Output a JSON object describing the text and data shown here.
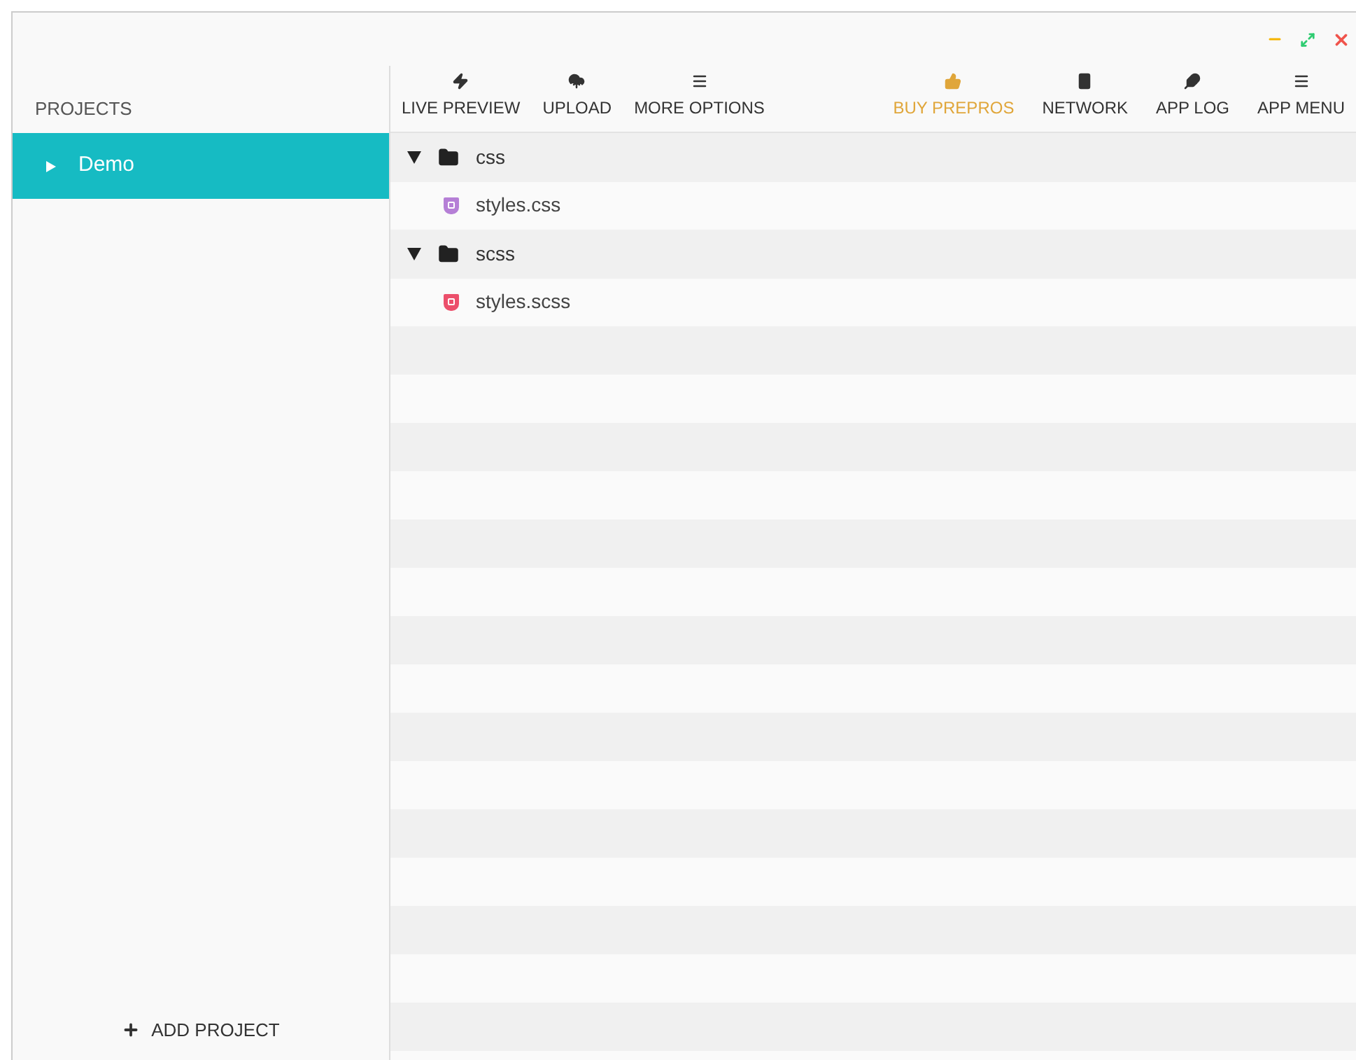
{
  "sidebar": {
    "heading": "PROJECTS",
    "projects": [
      {
        "name": "Demo",
        "selected": true
      }
    ],
    "add_button": "ADD PROJECT"
  },
  "toolbar": {
    "left": [
      {
        "label": "LIVE PREVIEW",
        "kind": "bolt",
        "highlighted": false
      },
      {
        "label": "UPLOAD",
        "kind": "cloud",
        "highlighted": false
      },
      {
        "label": "MORE OPTIONS",
        "kind": "menu",
        "highlighted": false
      }
    ],
    "right": [
      {
        "label": "BUY PREPROS",
        "kind": "thumb",
        "highlighted": true
      },
      {
        "label": "NETWORK",
        "kind": "phone",
        "highlighted": false
      },
      {
        "label": "APP LOG",
        "kind": "feather",
        "highlighted": false
      },
      {
        "label": "APP MENU",
        "kind": "menu",
        "highlighted": false
      }
    ]
  },
  "tree": [
    {
      "name": "css",
      "expanded": true,
      "children": [
        {
          "name": "styles.css",
          "color": "#b57fd6"
        }
      ]
    },
    {
      "name": "scss",
      "expanded": true,
      "children": [
        {
          "name": "styles.scss",
          "color": "#ec4f6b"
        }
      ]
    }
  ]
}
